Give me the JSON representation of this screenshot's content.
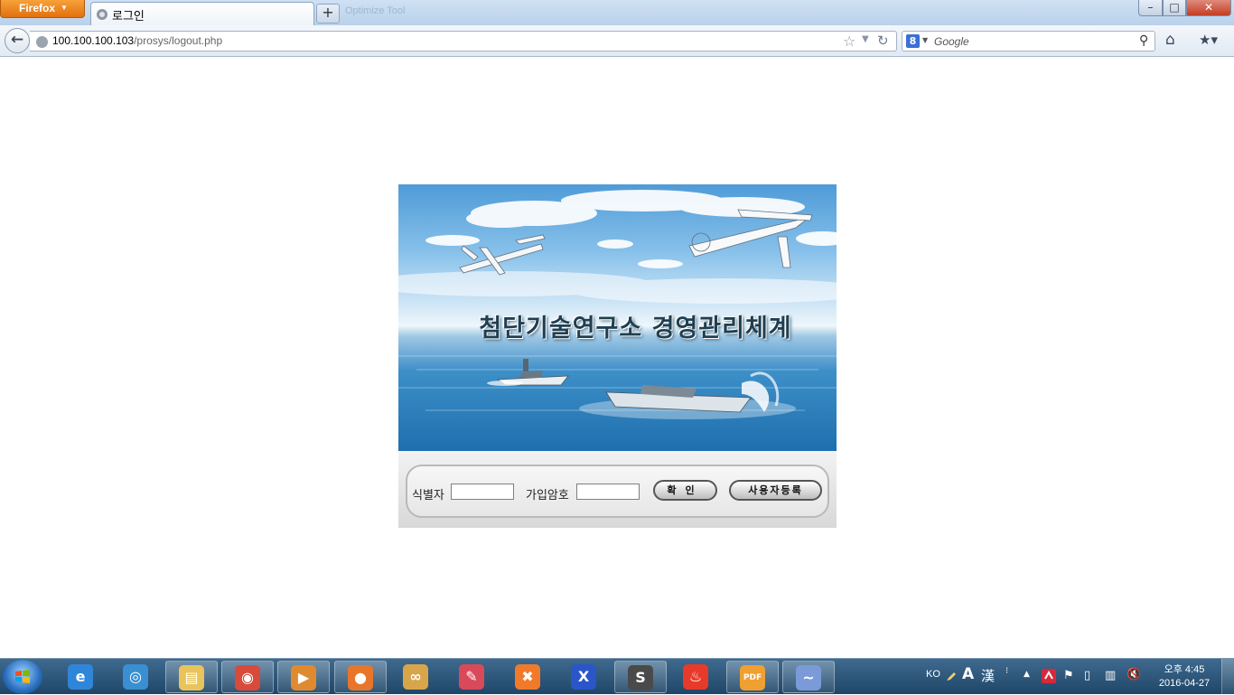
{
  "browser": {
    "menu_button": "Firefox",
    "tab_title": "로그인",
    "new_tab_symbol": "+",
    "ghost_tab_text": "Optimize Tool",
    "window_controls": {
      "minimize": "–",
      "maximize": "□",
      "close": "✕"
    },
    "url_host": "100.100.100.103",
    "url_path": "/prosys/logout.php",
    "search_engine": "8",
    "search_placeholder": "Google"
  },
  "login": {
    "hero_title": "첨단기술연구소 경영관리체계",
    "id_label": "식별자",
    "id_value": "",
    "password_label": "가입암호",
    "password_value": "",
    "confirm_label": "확인",
    "register_label": "사용자등록"
  },
  "taskbar": {
    "language": "KO",
    "ime_mode": "A",
    "ime_hanja": "漢",
    "clock_time": "오후 4:45",
    "clock_date": "2016-04-27",
    "apps": [
      {
        "name": "internet-explorer",
        "color": "#2f86d8",
        "glyph": "e"
      },
      {
        "name": "media-player",
        "color": "#3a8fd0",
        "glyph": "◎"
      },
      {
        "name": "file-explorer",
        "color": "#e8c45a",
        "glyph": "▤"
      },
      {
        "name": "chrome",
        "color": "#d84a3a",
        "glyph": "◉"
      },
      {
        "name": "video-player",
        "color": "#e08a30",
        "glyph": "▶"
      },
      {
        "name": "firefox",
        "color": "#e8762a",
        "glyph": "●"
      },
      {
        "name": "app-link",
        "color": "#d8a54a",
        "glyph": "∞"
      },
      {
        "name": "notepad-app",
        "color": "#d84a5a",
        "glyph": "✎"
      },
      {
        "name": "xampp",
        "color": "#f07a2a",
        "glyph": "✖"
      },
      {
        "name": "tool-app",
        "color": "#2a56c8",
        "glyph": "X"
      },
      {
        "name": "sublime-text",
        "color": "#4a4a4a",
        "glyph": "S"
      },
      {
        "name": "red-app",
        "color": "#e83a2a",
        "glyph": "♨"
      },
      {
        "name": "pdf-app",
        "color": "#f0a030",
        "glyph": "PDF"
      },
      {
        "name": "dolphin-app",
        "color": "#7a9ad8",
        "glyph": "~"
      }
    ]
  }
}
